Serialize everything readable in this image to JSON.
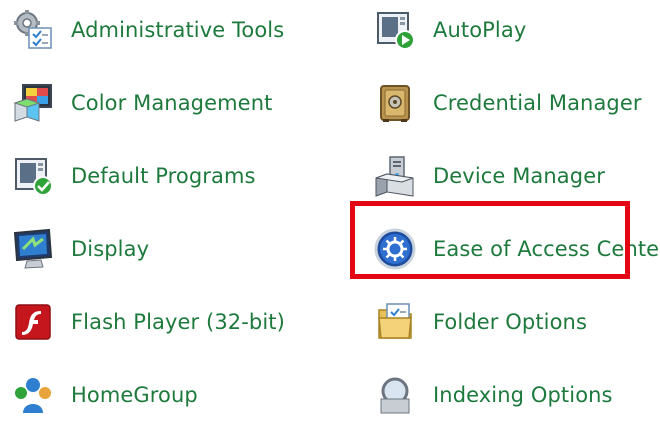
{
  "items": [
    {
      "label": "Administrative Tools",
      "icon": "administrative-tools-icon"
    },
    {
      "label": "AutoPlay",
      "icon": "autoplay-icon"
    },
    {
      "label": "Color Management",
      "icon": "color-management-icon"
    },
    {
      "label": "Credential Manager",
      "icon": "credential-manager-icon"
    },
    {
      "label": "Default Programs",
      "icon": "default-programs-icon"
    },
    {
      "label": "Device Manager",
      "icon": "device-manager-icon"
    },
    {
      "label": "Display",
      "icon": "display-icon"
    },
    {
      "label": "Ease of Access Center",
      "icon": "ease-of-access-icon"
    },
    {
      "label": "Flash Player (32-bit)",
      "icon": "flash-player-icon"
    },
    {
      "label": "Folder Options",
      "icon": "folder-options-icon"
    },
    {
      "label": "HomeGroup",
      "icon": "homegroup-icon"
    },
    {
      "label": "Indexing Options",
      "icon": "indexing-options-icon"
    }
  ],
  "colors": {
    "label": "#1e7a3c",
    "highlight": "#e30613"
  }
}
